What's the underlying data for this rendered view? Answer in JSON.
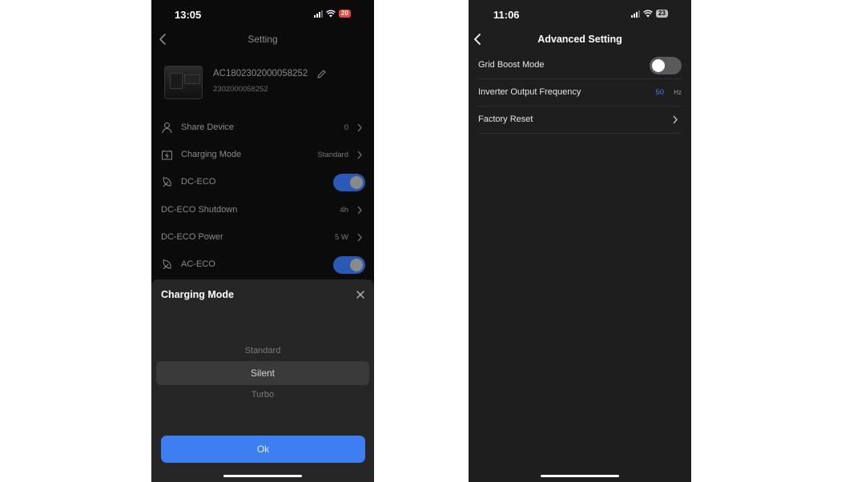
{
  "left_screen": {
    "status": {
      "time": "13:05",
      "battery": "20"
    },
    "nav": {
      "title": "Setting"
    },
    "device": {
      "name": "AC1802302000058252",
      "serial": "2302000058252"
    },
    "rows": [
      {
        "label": "Share Device",
        "value": "0",
        "icon": "person-icon"
      },
      {
        "label": "Charging Mode",
        "value": "Standard",
        "icon": "charging-mode-icon"
      },
      {
        "label": "DC-ECO",
        "toggle": "on",
        "icon": "eco-icon"
      },
      {
        "label": "DC-ECO Shutdown",
        "value": "4h"
      },
      {
        "label": "DC-ECO Power",
        "value": "5 W"
      },
      {
        "label": "AC-ECO",
        "toggle": "on",
        "icon": "eco-icon"
      }
    ],
    "sheet": {
      "title": "Charging Mode",
      "options": [
        "Standard",
        "Silent",
        "Turbo"
      ],
      "selected": "Silent",
      "ok_label": "Ok"
    }
  },
  "right_screen": {
    "status": {
      "time": "11:06",
      "battery": "23"
    },
    "nav": {
      "title": "Advanced Setting"
    },
    "rows": [
      {
        "label": "Grid Boost Mode",
        "toggle": "off"
      },
      {
        "label": "Inverter Output Frequency",
        "value": "50",
        "unit": "Hz"
      },
      {
        "label": "Factory Reset"
      }
    ]
  },
  "colors": {
    "accent": "#3d7ef0",
    "toggle_on": "#2a59b6",
    "battery_low": "#e8473a"
  }
}
